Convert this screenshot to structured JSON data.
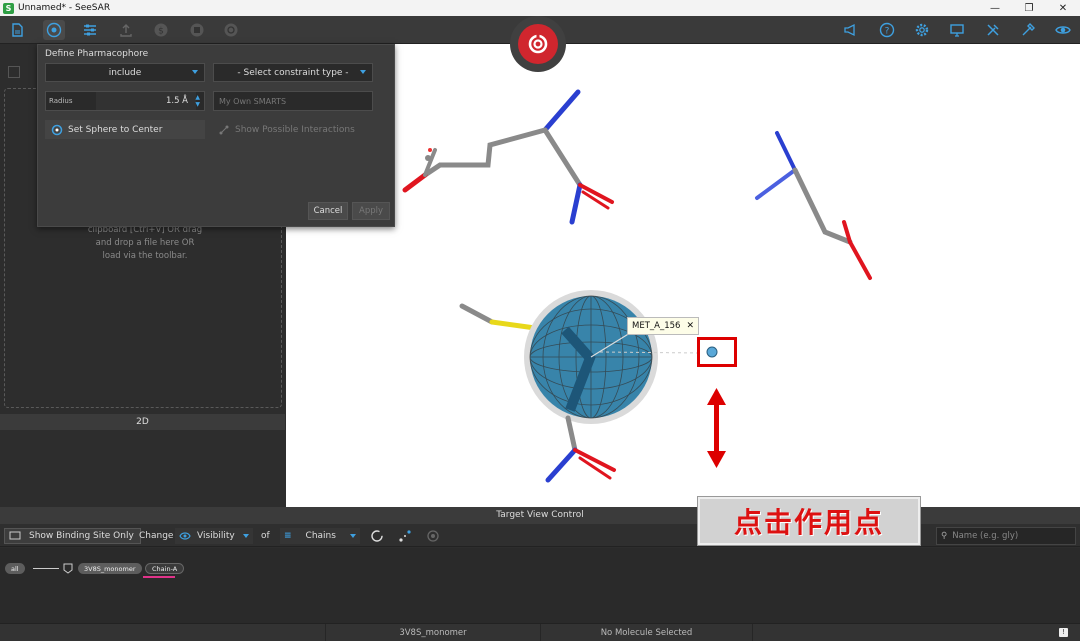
{
  "window": {
    "title": "Unnamed* - SeeSAR",
    "controls": [
      "—",
      "❐",
      "✕"
    ]
  },
  "dialog": {
    "title": "Define Pharmacophore",
    "mode_select": "include",
    "constraint_select": "- Select constraint type -",
    "radius_label": "Radius",
    "radius_value": "1.5 Å",
    "smarts_placeholder": "My Own SMARTS",
    "set_sphere_label": "Set Sphere to Center",
    "show_interactions_label": "Show Possible Interactions",
    "cancel_label": "Cancel",
    "apply_label": "Apply"
  },
  "left_panel": {
    "drop_text_1": "clipboard [Ctrl+V] OR drag",
    "drop_text_2": "and drop a file here OR",
    "drop_text_3": "load via the toolbar.",
    "label_2d": "2D"
  },
  "viewport": {
    "residue_label": "MET_A_156",
    "annotation_text": "点击作用点"
  },
  "target_view": {
    "header": "Target View Control",
    "show_binding_site": "Show Binding Site Only",
    "change_label": "Change",
    "visibility_label": "Visibility",
    "of_label": "of",
    "chains_label": "Chains",
    "name_placeholder": "Name (e.g. gly)",
    "pill_all": "all",
    "pill_monomer": "3V8S_monomer",
    "pill_chain": "Chain-A"
  },
  "status": {
    "molecule": "3V8S_monomer",
    "selection": "No Molecule Selected"
  },
  "colors": {
    "accent_blue": "#3ea0e0",
    "logo_red": "#d0262e",
    "highlight_red": "#dd0000",
    "chain_underline": "#e0338a"
  }
}
